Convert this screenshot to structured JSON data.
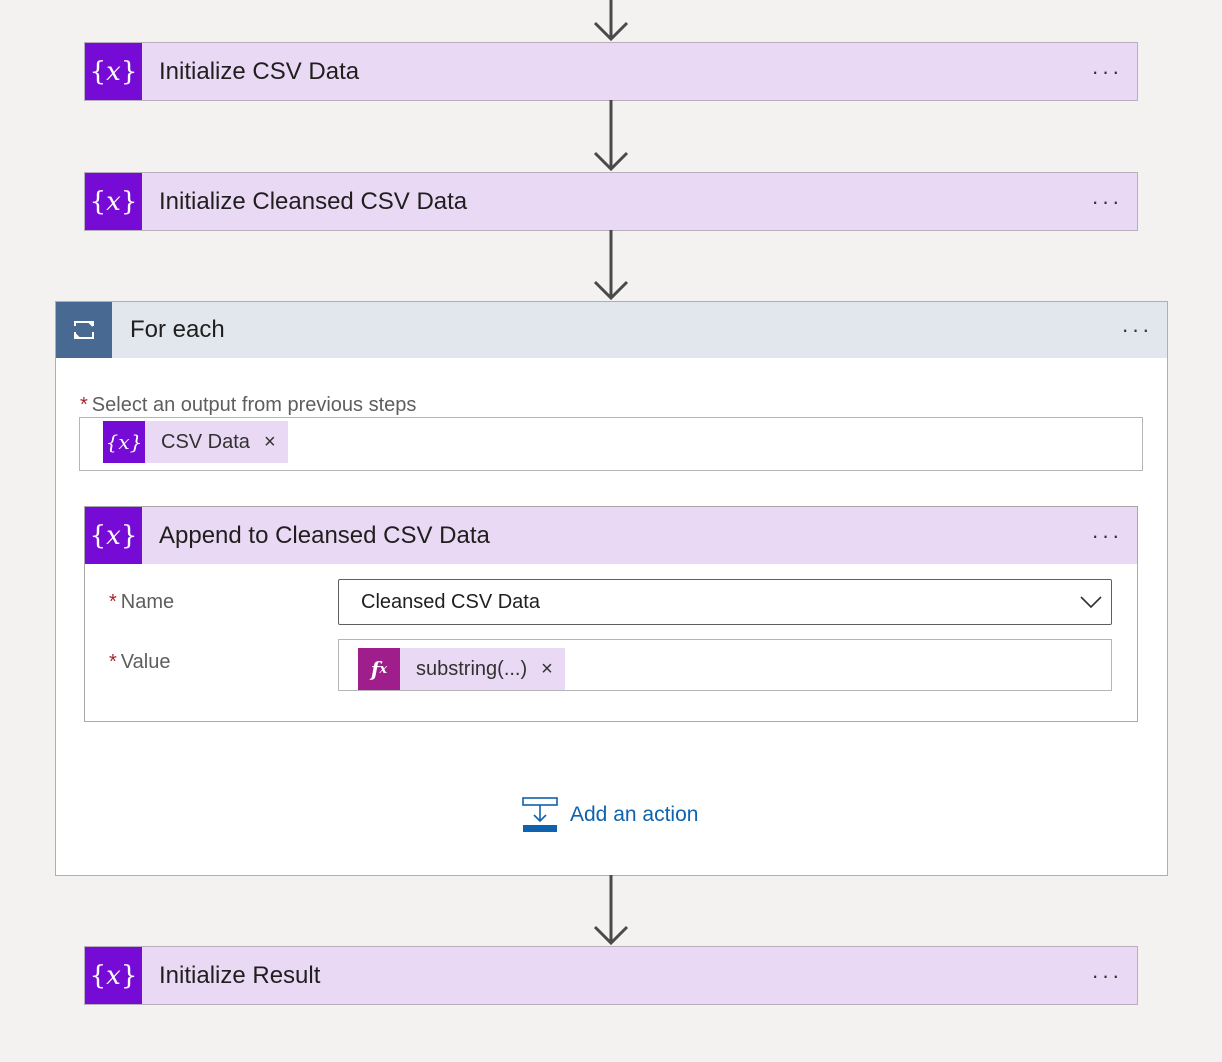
{
  "steps": {
    "init_csv": {
      "title": "Initialize CSV Data",
      "more": "···"
    },
    "init_cleansed": {
      "title": "Initialize Cleansed CSV Data",
      "more": "···"
    },
    "foreach": {
      "title": "For each",
      "more": "···",
      "select_label": "Select an output from previous steps",
      "required_mark": "*",
      "token": {
        "label": "CSV Data",
        "remove": "×"
      },
      "append": {
        "title": "Append to Cleansed CSV Data",
        "more": "···",
        "name_label": "Name",
        "name_value": "Cleansed CSV Data",
        "value_label": "Value",
        "value_token": {
          "label": "substring(...)",
          "remove": "×"
        }
      },
      "add_action_label": "Add an action"
    },
    "init_result": {
      "title": "Initialize Result",
      "more": "···"
    }
  },
  "colors": {
    "variable_icon": "#770bd6",
    "card_bg": "#e9d9f5",
    "loop_icon": "#486991",
    "expression_icon": "#a01d8c",
    "link": "#0f62ae"
  },
  "icons": {
    "variable": "variable-braces-icon",
    "loop": "loop-icon",
    "expression": "fx-icon",
    "add_action": "add-action-icon",
    "chevron": "chevron-down-icon",
    "arrow": "arrow-down-icon"
  }
}
